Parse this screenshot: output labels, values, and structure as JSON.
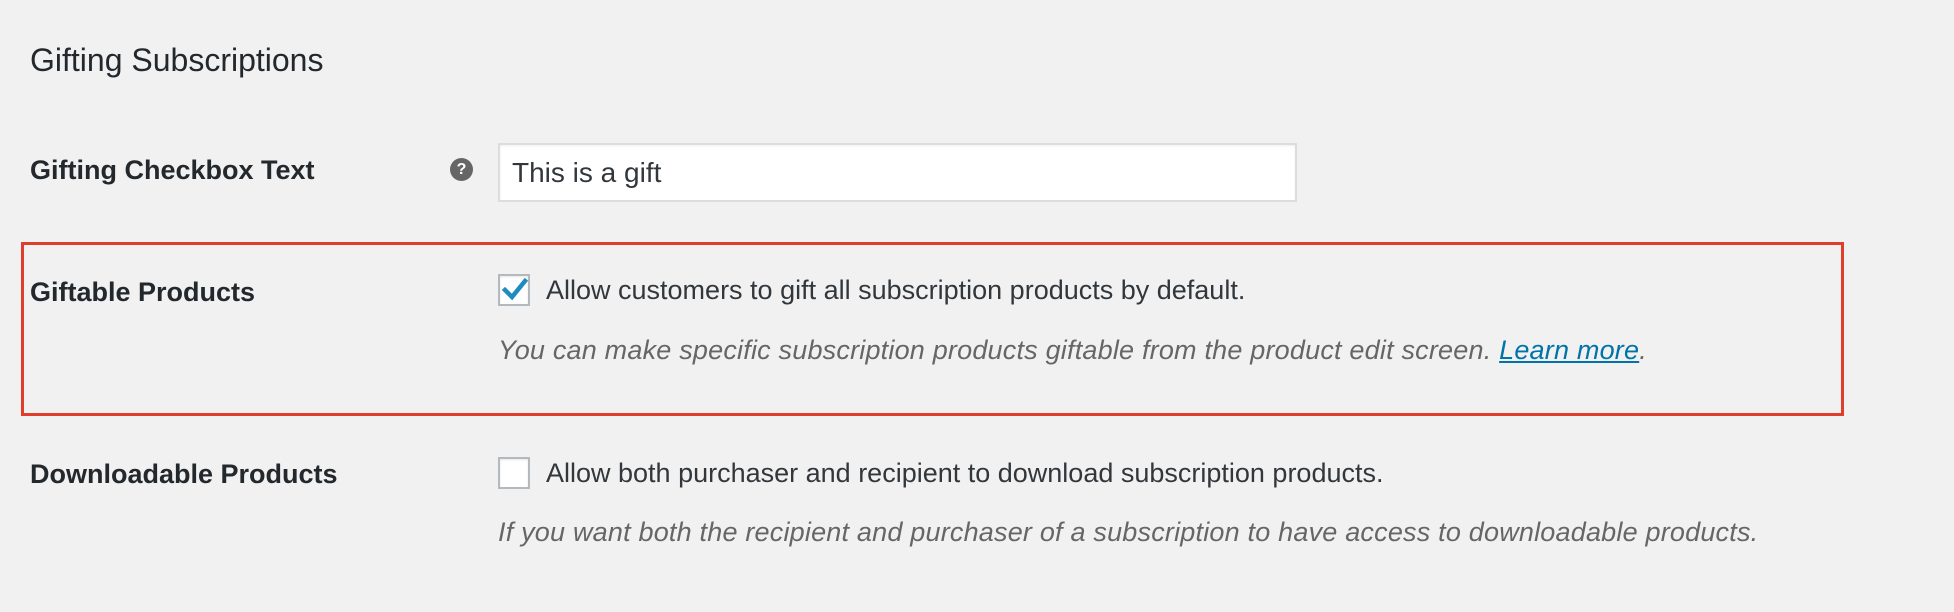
{
  "section": {
    "title": "Gifting Subscriptions"
  },
  "gifting_checkbox_text": {
    "label": "Gifting Checkbox Text",
    "help_icon": "question-mark-icon",
    "help_glyph": "?",
    "value": "This is a gift"
  },
  "giftable_products": {
    "label": "Giftable Products",
    "checked": true,
    "checkbox_label": "Allow customers to gift all subscription products by default.",
    "description": "You can make specific subscription products giftable from the product edit screen.",
    "link_text": "Learn more",
    "description_end": "."
  },
  "downloadable_products": {
    "label": "Downloadable Products",
    "checked": false,
    "checkbox_label": "Allow both purchaser and recipient to download subscription products.",
    "description": "If you want both the recipient and purchaser of a subscription to have access to downloadable products."
  },
  "colors": {
    "background": "#f1f1f1",
    "highlight_border": "#e03e2d",
    "checkmark": "#1e8cbe",
    "link": "#0073aa"
  }
}
